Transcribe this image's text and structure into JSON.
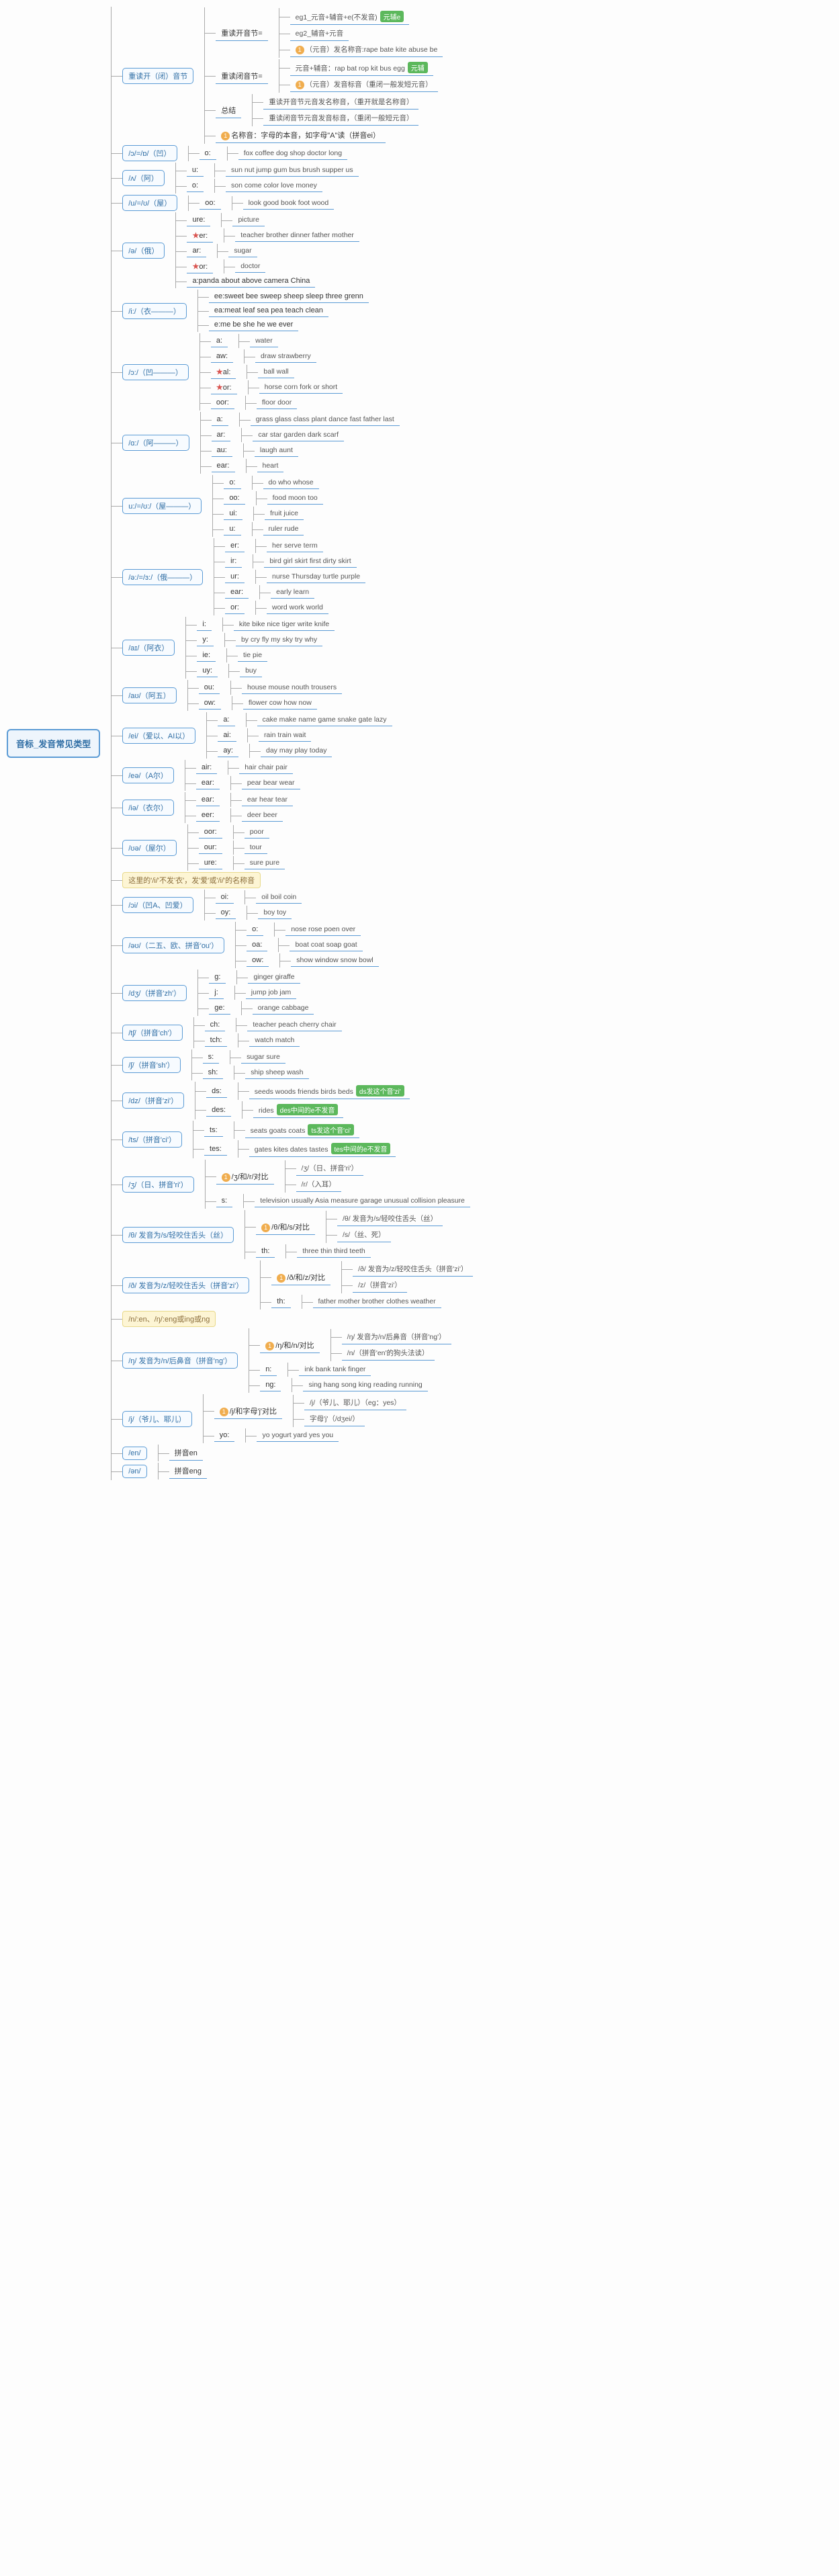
{
  "root": "音标_发音常见类型",
  "n": {
    "a": "重读开（闭）音节",
    "a1": "重读开音节=",
    "a1a": "eg1_元音+辅音+e(不发音)",
    "a1b": "eg2_辅音+元音",
    "a1c": "（元音）发名称音:rape bate kite abuse be",
    "tag_yfe": "元辅e",
    "a2": "重读闭音节=",
    "a2a": "元音+辅音：rap bat rop kit bus egg",
    "a2b": "（元音）发音标音（重闭一般发短元音）",
    "tag_yf": "元辅",
    "a3": "总结",
    "a3a": "重读开音节元音发名称音，（重开就是名称音）",
    "a3b": "重读闭音节元音发音标音，（重闭一般短元音）",
    "a4": "名称音：字母的本音，如字母\"A\"读（拼音ei）",
    "b": "/ɔ/=/ɒ/（凹）",
    "b1": "o:",
    "b1v": "fox coffee dog shop doctor long",
    "c": "/ʌ/（阿）",
    "c1": "u:",
    "c1v": "sun nut jump gum bus brush supper us",
    "c2": "o:",
    "c2v": "son come color love money",
    "d": "/u/=/ʊ/（屋）",
    "d1": "oo:",
    "d1v": "look good book foot wood",
    "e": "/ə/（俄）",
    "e1": "ure:",
    "e1v": "picture",
    "e2": "er:",
    "e2v": "teacher brother dinner father mother",
    "e3": "ar:",
    "e3v": "sugar",
    "e4": "or:",
    "e4v": "doctor",
    "e5": "a:panda about above camera China",
    "f": "/i:/（衣———）",
    "f1": "ee:sweet bee sweep sheep sleep three grenn",
    "f2": "ea:meat leaf sea pea teach clean",
    "f3": "e:me be she he we ever",
    "g": "/ɔ:/（凹———）",
    "g1": "a:",
    "g1v": "water",
    "g2": "aw:",
    "g2v": "draw strawberry",
    "g3": "al:",
    "g3v": "ball wall",
    "g4": "or:",
    "g4v": "horse corn fork or short",
    "g5": "oor:",
    "g5v": "floor door",
    "h": "/ɑ:/（阿———）",
    "h1": "a:",
    "h1v": "grass glass class plant dance fast father last",
    "h2": "ar:",
    "h2v": "car star garden dark scarf",
    "h3": "au:",
    "h3v": "laugh aunt",
    "h4": "ear:",
    "h4v": "heart",
    "i": "u:/=/ʊ:/（屋———）",
    "i1": "o:",
    "i1v": "do who whose",
    "i2": "oo:",
    "i2v": "food moon too",
    "i3": "ui:",
    "i3v": "fruit juice",
    "i4": "u:",
    "i4v": "ruler rude",
    "j": "/ə:/=/ɜ:/（俄———）",
    "j1": "er:",
    "j1v": "her serve term",
    "j2": "ir:",
    "j2v": "bird girl skirt first dirty skirt",
    "j3": "ur:",
    "j3v": "nurse Thursday turtle purple",
    "j4": "ear:",
    "j4v": "early learn",
    "j5": "or:",
    "j5v": "word work world",
    "k": "/aɪ/（阿衣）",
    "k1": "i:",
    "k1v": "kite bike nice tiger write knife",
    "k2": "y:",
    "k2v": "by cry fly my sky try why",
    "k3": "ie:",
    "k3v": "tie pie",
    "k4": "uy:",
    "k4v": "buy",
    "l": "/aʊ/（阿五）",
    "l1": "ou:",
    "l1v": "house mouse nouth trousers",
    "l2": "ow:",
    "l2v": "flower cow how now",
    "m": "/ei/（爱以、AI以）",
    "m1": "a:",
    "m1v": "cake make name game snake gate lazy",
    "m2": "ai:",
    "m2v": "rain train wait",
    "m3": "ay:",
    "m3v": "day may play today",
    "n1": "/eə/（A尔）",
    "n1a": "air:",
    "n1av": "hair chair pair",
    "n1b": "ear:",
    "n1bv": "pear bear wear",
    "o": "/iə/（衣尔）",
    "o1": "ear:",
    "o1v": "ear hear tear",
    "o2": "eer:",
    "o2v": "deer beer",
    "p": "/ʊə/（屋尔）",
    "p1": "oor:",
    "p1v": "poor",
    "p2": "our:",
    "p2v": "tour",
    "p3": "ure:",
    "p3v": "sure pure",
    "call1": "这里的'/i/'不发'衣'，发'爱'或'/i/'的名称音",
    "q": "/ɔi/（凹A、凹爱）",
    "q1": "oi:",
    "q1v": "oil boil coin",
    "q2": "oy:",
    "q2v": "boy toy",
    "r": "/əʊ/（二五、欧、拼音'ou'）",
    "r1": "o:",
    "r1v": "nose rose poen over",
    "r2": "oa:",
    "r2v": "boat coat soap goat",
    "r3": "ow:",
    "r3v": "show window snow bowl",
    "s": "/dʒ/（拼音'zh'）",
    "s1": "g:",
    "s1v": "ginger giraffe",
    "s2": "j:",
    "s2v": "jump job jam",
    "s3": "ge:",
    "s3v": "orange cabbage",
    "t": "/tʃ/（拼音'ch'）",
    "t1": "ch:",
    "t1v": "teacher peach cherry chair",
    "t2": "tch:",
    "t2v": "watch match",
    "u": "/ʃ/（拼音'sh'）",
    "u1": "s:",
    "u1v": "sugar sure",
    "u2": "sh:",
    "u2v": "ship sheep wash",
    "v": "/dz/（拼音'zi'）",
    "v1": "ds:",
    "v1v": "seeds woods friends birds beds",
    "v2": "des:",
    "v2v": "rides",
    "tag_ds": "ds发这个音'zi'",
    "tag_des": "des中间的e不发音",
    "w": "/ts/（拼音'ci'）",
    "w1": "ts:",
    "w1v": "seats goats coats",
    "w2": "tes:",
    "w2v": "gates kites dates tastes",
    "tag_ts": "ts发这个音'ci'",
    "tag_tes": "tes中间的e不发音",
    "x": "/ʒ/（日、拼音'ri'）",
    "x1": "/ʒ/和/r/对比",
    "x1a": "/ʒ/（日、拼音'ri'）",
    "x1b": "/r/（入耳）",
    "x2": "s:",
    "x2v": "television usually Asia measure garage unusual collision pleasure",
    "y": "/θ/ 发音为/s/轻咬住舌头（丝）",
    "y1": "/θ/和/s/对比",
    "y1a": "/θ/ 发音为/s/轻咬住舌头（丝）",
    "y1b": "/s/（丝、死）",
    "y2": "th:",
    "y2v": "three thin third teeth",
    "z": "/ð/ 发音为/z/轻咬住舌头（拼音'zi'）",
    "z1": "/ð/和/z/对比",
    "z1a": "/ð/ 发音为/z/轻咬住舌头（拼音'zi'）",
    "z1b": "/z/（拼音'zi'）",
    "z2": "th:",
    "z2v": "father mother brother clothes weather",
    "call2": "/n/:en、/ŋ/:eng或ing或ng",
    "aa": "/ŋ/ 发音为/n/后鼻音（拼音'ng'）",
    "aa1": "/ŋ/和/n/对比",
    "aa1a": "/ŋ/ 发音为/n/后鼻音（拼音'ng'）",
    "aa1b": "/n/（拼音'en'的狗头法读）",
    "aa2": "n:",
    "aa2v": "ink bank tank finger",
    "aa3": "ng:",
    "aa3v": "sing hang song king reading running",
    "bb": "/j/（爷儿、耶儿）",
    "bb1": "/j/和字母'j'对比",
    "bb1a": "/j/（爷儿、耶儿）（eg：yes）",
    "bb1b": "字母'j'（/dʒei/）",
    "bb2": "yo:",
    "bb2v": "yo yogurt yard yes you",
    "cc": "/en/",
    "ccv": "拼音en",
    "dd": "/ən/",
    "ddv": "拼音eng"
  }
}
